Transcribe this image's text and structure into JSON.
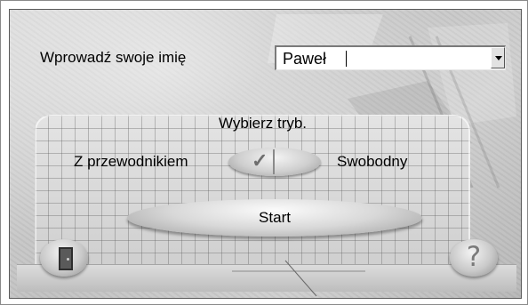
{
  "form": {
    "name_label": "Wprowadź swoje imię",
    "name_value": "Paweł"
  },
  "mode": {
    "title": "Wybierz tryb.",
    "left_option": "Z przewodnikiem",
    "right_option": "Swobodny",
    "selected": "Z przewodnikiem"
  },
  "buttons": {
    "start_label": "Start",
    "exit_icon": "door-icon",
    "help_icon": "question-mark-icon"
  },
  "icons": {
    "toggle_check": "✓",
    "help_glyph": "?"
  },
  "colors": {
    "background": "#c8c8c8",
    "button_face": "#d8d8d8",
    "text": "#000000"
  }
}
